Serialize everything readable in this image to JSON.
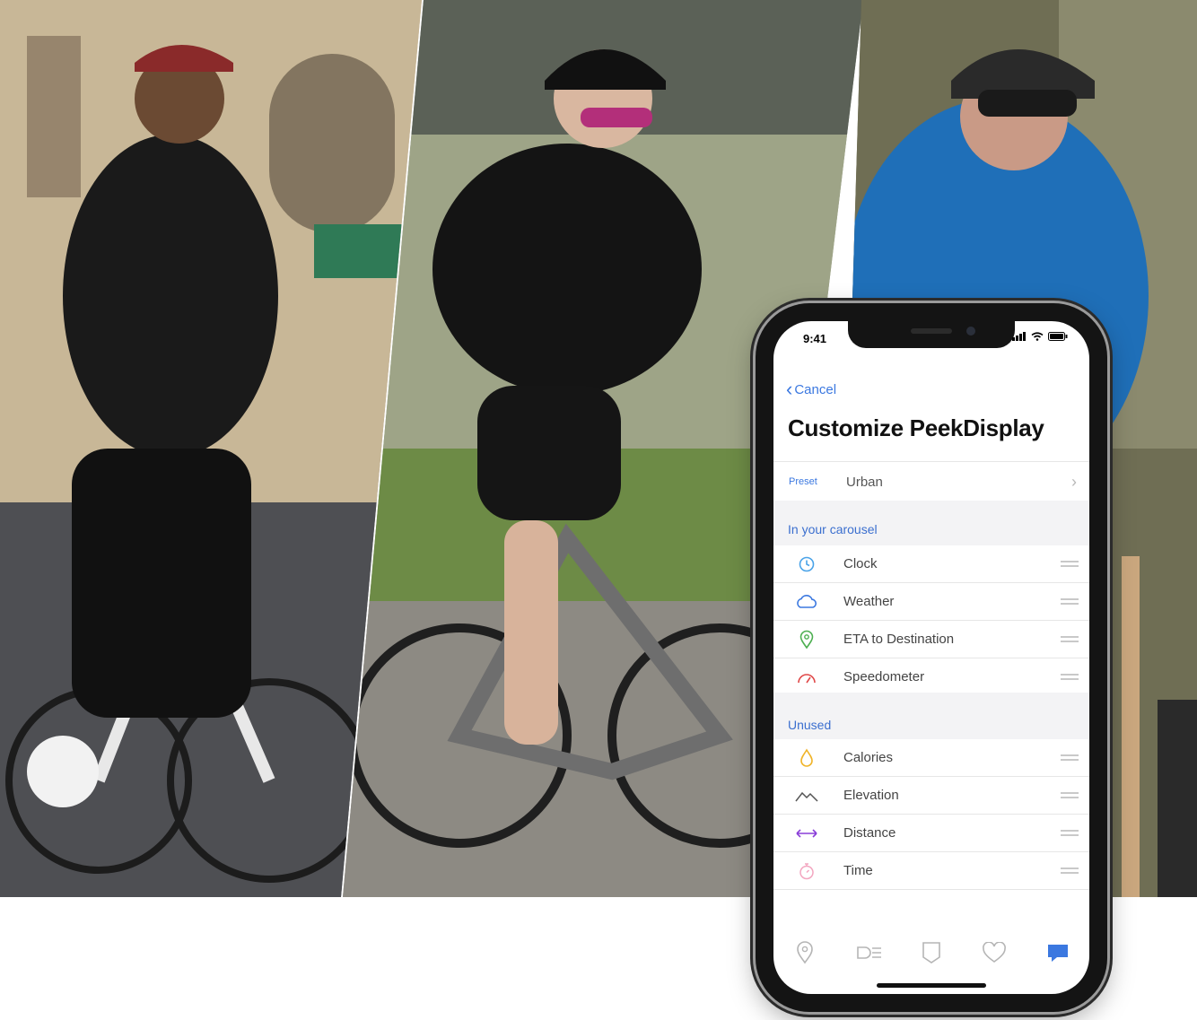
{
  "status_bar": {
    "time": "9:41",
    "icons": "…ıl ◔ ▬"
  },
  "nav": {
    "cancel_label": "Cancel"
  },
  "screen_title": "Customize PeekDisplay",
  "preset": {
    "label": "Preset",
    "value": "Urban"
  },
  "sections": {
    "carousel": {
      "title": "In your carousel",
      "items": [
        {
          "label": "Clock",
          "icon": "clock-icon",
          "color": "#4aa3e8"
        },
        {
          "label": "Weather",
          "icon": "cloud-icon",
          "color": "#3b78e0"
        },
        {
          "label": "ETA to Destination",
          "icon": "location-pin-icon",
          "color": "#4caf50"
        },
        {
          "label": "Speedometer",
          "icon": "speedometer-icon",
          "color": "#e04848"
        }
      ]
    },
    "unused": {
      "title": "Unused",
      "items": [
        {
          "label": "Calories",
          "icon": "flame-icon",
          "color": "#f0b429"
        },
        {
          "label": "Elevation",
          "icon": "elevation-icon",
          "color": "#555555"
        },
        {
          "label": "Distance",
          "icon": "distance-arrows-icon",
          "color": "#8a3fd8"
        },
        {
          "label": "Time",
          "icon": "stopwatch-icon",
          "color": "#f3a6c0"
        }
      ]
    }
  },
  "tabs": [
    {
      "icon": "map-pin-tab-icon",
      "active": false
    },
    {
      "icon": "headlight-tab-icon",
      "active": false
    },
    {
      "icon": "badge-tab-icon",
      "active": false
    },
    {
      "icon": "heart-tab-icon",
      "active": false
    },
    {
      "icon": "chat-tab-icon",
      "active": true
    }
  ],
  "colors": {
    "accent": "#3b78e0",
    "inactive_tab": "#b5b5b5"
  }
}
